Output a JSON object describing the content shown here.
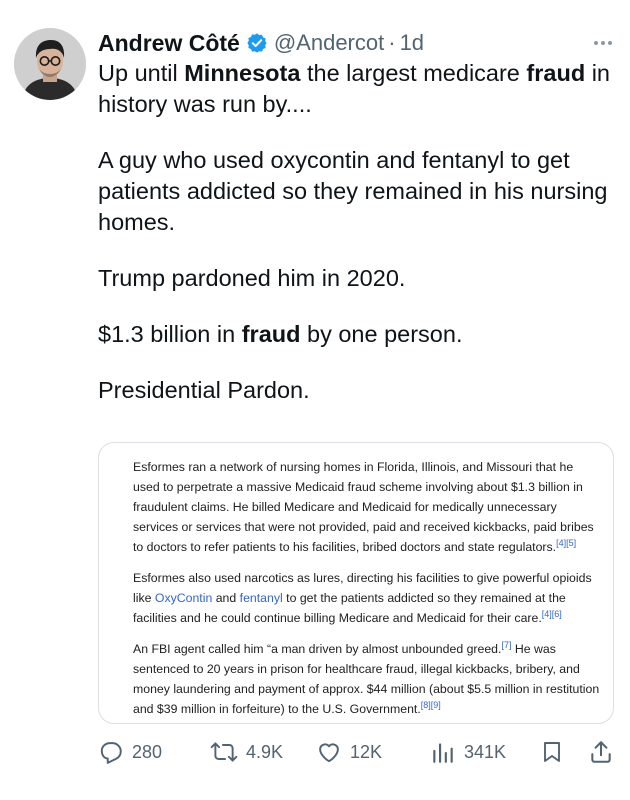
{
  "author": {
    "name": "Andrew Côté",
    "handle": "@Andercot",
    "separator": "·",
    "time": "1d",
    "avatar_icon": "person-portrait-avatar",
    "verified_color": "#1d9bf0"
  },
  "tweet": {
    "l1a": "Up until ",
    "l1b": "Minnesota",
    "l1c": " the largest medicare ",
    "l1d": "fraud",
    "l1e": " in history was run by....",
    "p2": "A guy who used oxycontin and fentanyl to get patients addicted so they remained in his nursing homes.",
    "p3": "Trump pardoned him in 2020.",
    "p4a": "$1.3 billion in ",
    "p4b": "fraud",
    "p4c": " by one person.",
    "p5": "Presidential Pardon."
  },
  "card": {
    "para1": "Esformes ran a network of nursing homes in Florida, Illinois, and Missouri that he used to perpetrate a massive Medicaid fraud scheme involving about $1.3 billion in fraudulent claims. He billed Medicare and Medicaid for medically unnecessary services or services that were not provided, paid and received kickbacks, paid bribes to doctors to refer patients to his facilities, bribed doctors and state regulators.",
    "ref1": "[4][5]",
    "para2a": "Esformes also used narcotics as lures, directing his facilities to give powerful opioids like ",
    "link1": "OxyContin",
    "para2b": " and ",
    "link2": "fentanyl",
    "para2c": " to get the patients addicted so they remained at the facilities and he could continue billing Medicare and Medicaid for their care.",
    "ref2": "[4][6]",
    "para3a": "An FBI agent called him “a man driven by almost unbounded greed.",
    "ref3": "[7]",
    "para3b": " He was sentenced to 20 years in prison for healthcare fraud, illegal kickbacks, bribery, and money laundering and payment of approx. $44 million (about $5.5 million in restitution and $39 million in forfeiture) to the U.S. Government.",
    "ref4": "[8][9]"
  },
  "actions": {
    "replies": "280",
    "reposts": "4.9K",
    "likes": "12K",
    "views": "341K",
    "icons": [
      "reply-icon",
      "repost-icon",
      "like-icon",
      "views-icon",
      "bookmark-icon",
      "share-icon"
    ]
  }
}
